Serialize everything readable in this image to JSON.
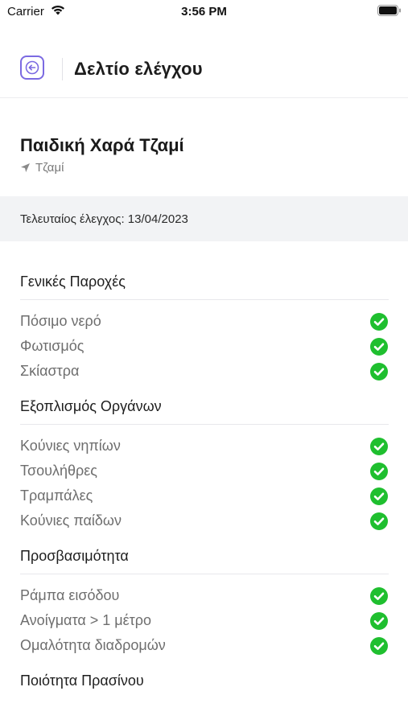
{
  "status_bar": {
    "carrier": "Carrier",
    "time": "3:56 PM"
  },
  "header": {
    "title": "Δελτίο ελέγχου",
    "back_icon": "arrow-left-icon"
  },
  "park": {
    "name": "Παιδική Χαρά Τζαμί",
    "location": "Τζαμί",
    "location_icon": "location-arrow-icon"
  },
  "last_check": {
    "text": "Τελευταίος έλεγχος: 13/04/2023"
  },
  "sections": [
    {
      "title": "Γενικές Παροχές",
      "items": [
        {
          "label": "Πόσιμο νερό",
          "checked": true
        },
        {
          "label": "Φωτισμός",
          "checked": true
        },
        {
          "label": "Σκίαστρα",
          "checked": true
        }
      ]
    },
    {
      "title": "Εξοπλισμός Οργάνων",
      "items": [
        {
          "label": "Κούνιες νηπίων",
          "checked": true
        },
        {
          "label": "Τσουλήθρες",
          "checked": true
        },
        {
          "label": "Τραμπάλες",
          "checked": true
        },
        {
          "label": "Κούνιες παίδων",
          "checked": true
        }
      ]
    },
    {
      "title": "Προσβασιμότητα",
      "items": [
        {
          "label": "Ράμπα εισόδου",
          "checked": true
        },
        {
          "label": "Ανοίγματα > 1 μέτρο",
          "checked": true
        },
        {
          "label": "Ομαλότητα διαδρομών",
          "checked": true
        }
      ]
    },
    {
      "title": "Ποιότητα Πρασίνου",
      "items": []
    }
  ],
  "colors": {
    "accent": "#7b6ae2",
    "check_green": "#1fbf2f",
    "banner_bg": "#f2f3f5"
  }
}
